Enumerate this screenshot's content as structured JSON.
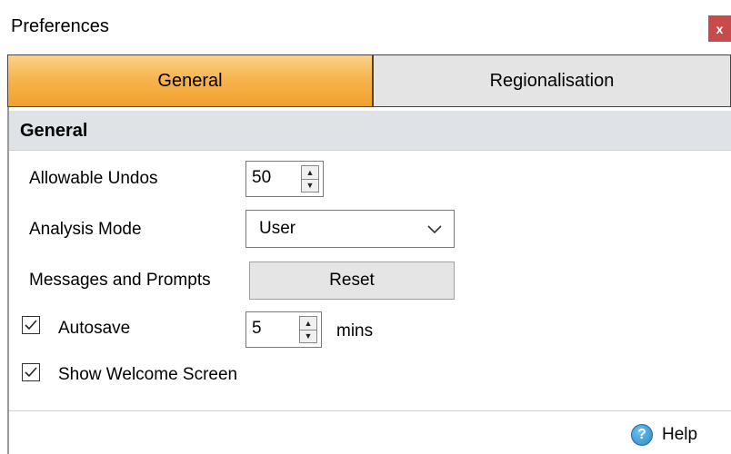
{
  "window": {
    "title": "Preferences",
    "close_glyph": "x"
  },
  "tabs": [
    {
      "label": "General",
      "active": true
    },
    {
      "label": "Regionalisation",
      "active": false
    }
  ],
  "section": {
    "title": "General"
  },
  "fields": {
    "allowable_undos": {
      "label": "Allowable Undos",
      "value": "50"
    },
    "analysis_mode": {
      "label": "Analysis Mode",
      "value": "User"
    },
    "messages_prompts": {
      "label": "Messages and Prompts",
      "button_label": "Reset"
    },
    "autosave": {
      "label": "Autosave",
      "checked": true,
      "value": "5",
      "unit": "mins"
    },
    "show_welcome": {
      "label": "Show Welcome Screen",
      "checked": true
    }
  },
  "footer": {
    "help_label": "Help",
    "help_icon": "question-circle-icon"
  },
  "colors": {
    "active_tab": "#f7b54f",
    "inactive_tab": "#e4e4e4",
    "section_header": "#dfe3e8",
    "close_button": "#c84a4a",
    "help_icon": "#2d86c7"
  }
}
